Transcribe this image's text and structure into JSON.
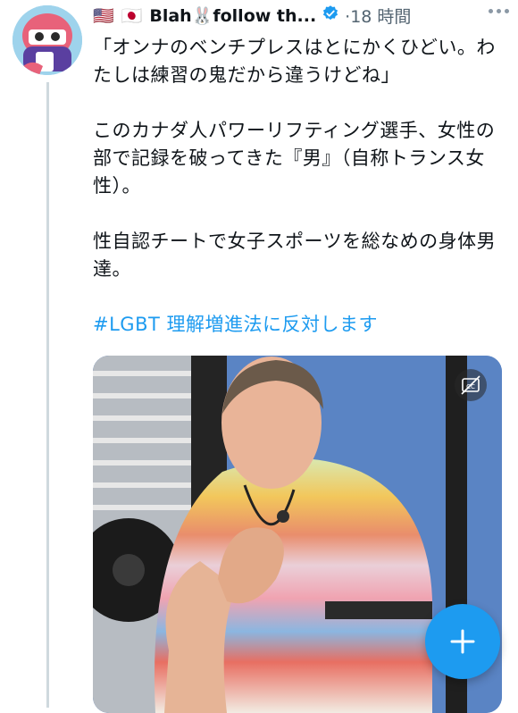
{
  "tweet": {
    "flags": [
      "🇺🇸",
      "🇯🇵"
    ],
    "display_name": "Blah🐰follow th...",
    "time_separator": "·",
    "time": "18 時間",
    "paragraphs": [
      "「オンナのベンチプレスはとにかくひどい。わたしは練習の鬼だから違うけどね」",
      "このカナダ人パワーリフティング選手、女性の部で記録を破ってきた『男』（自称トランス女性）。",
      "性自認チートで女子スポーツを総なめの身体男達。"
    ],
    "hashtag": "#LGBT 理解増進法に反対します"
  },
  "icons": {
    "verified": "verified-badge-icon",
    "more": "more-options-icon",
    "captions": "closed-captions-icon",
    "compose": "compose-plus-icon"
  },
  "colors": {
    "accent": "#1d9bf0",
    "text": "#0f1419",
    "secondary": "#536471",
    "thread_line": "#cfd9de"
  }
}
